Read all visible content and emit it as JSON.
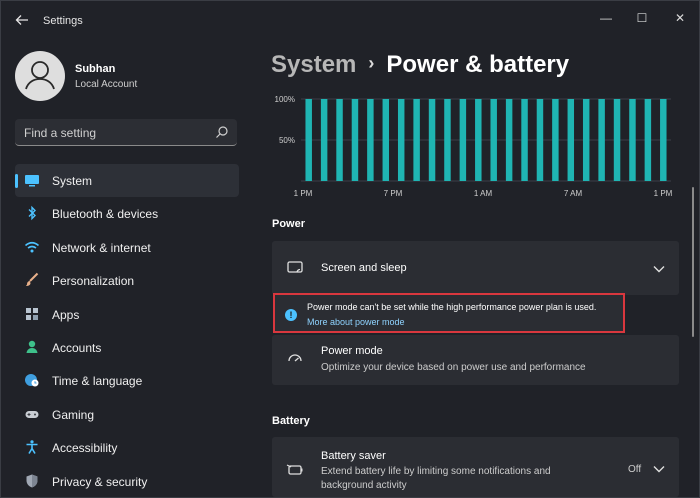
{
  "window": {
    "title": "Settings",
    "minimize": "—",
    "maximize": "☐",
    "close": "✕"
  },
  "user": {
    "name": "Subhan",
    "account": "Local Account"
  },
  "search": {
    "placeholder": "Find a setting"
  },
  "sidebar": {
    "items": [
      {
        "label": "System",
        "icon": "monitor-icon",
        "active": true
      },
      {
        "label": "Bluetooth & devices",
        "icon": "bluetooth-icon"
      },
      {
        "label": "Network & internet",
        "icon": "wifi-icon"
      },
      {
        "label": "Personalization",
        "icon": "brush-icon"
      },
      {
        "label": "Apps",
        "icon": "apps-icon"
      },
      {
        "label": "Accounts",
        "icon": "person-icon"
      },
      {
        "label": "Time & language",
        "icon": "globe-clock-icon"
      },
      {
        "label": "Gaming",
        "icon": "gamepad-icon"
      },
      {
        "label": "Accessibility",
        "icon": "accessibility-icon"
      },
      {
        "label": "Privacy & security",
        "icon": "shield-icon"
      }
    ]
  },
  "breadcrumb": {
    "parent": "System",
    "separator": "›",
    "current": "Power & battery"
  },
  "chart_data": {
    "type": "bar",
    "y_ticks": [
      "100%",
      "50%"
    ],
    "x_ticks": [
      "1 PM",
      "7 PM",
      "1 AM",
      "7 AM",
      "1 PM"
    ],
    "ylim": [
      0,
      100
    ],
    "values": [
      100,
      100,
      100,
      100,
      100,
      100,
      100,
      100,
      100,
      100,
      100,
      100,
      100,
      100,
      100,
      100,
      100,
      100,
      100,
      100,
      100,
      100,
      100,
      100
    ],
    "bar_color": "#1fb5b3",
    "grid": true
  },
  "power": {
    "section_label": "Power",
    "screen_sleep": {
      "title": "Screen and sleep"
    },
    "warning": {
      "text": "Power mode can't be set while the high performance power plan is used.",
      "link": "More about power mode"
    },
    "power_mode": {
      "title": "Power mode",
      "subtitle": "Optimize your device based on power use and performance"
    }
  },
  "battery": {
    "section_label": "Battery",
    "saver": {
      "title": "Battery saver",
      "subtitle_line1": "Extend battery life by limiting some notifications and",
      "subtitle_line2": "background activity",
      "state": "Off"
    }
  },
  "colors": {
    "accent": "#4cc2ff",
    "warning_border": "#d9373e",
    "bar": "#1fb5b3"
  }
}
